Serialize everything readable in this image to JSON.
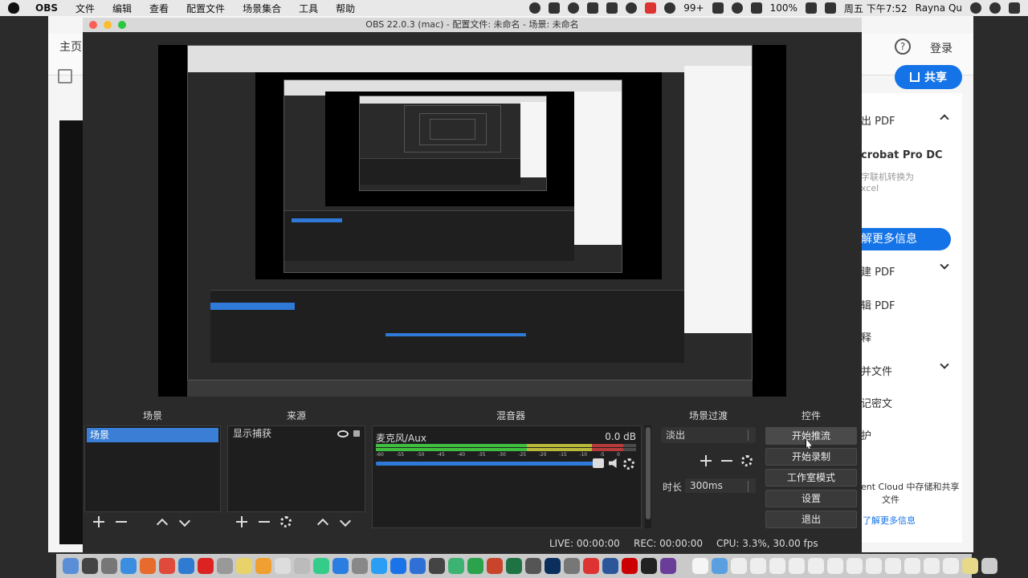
{
  "menubar": {
    "app_name": "OBS",
    "menus": [
      "文件",
      "编辑",
      "查看",
      "配置文件",
      "场景集合",
      "工具",
      "帮助"
    ],
    "notif_count": "99+",
    "battery": "100%",
    "clock": "周五 下午7:52",
    "user": "Rayna Qu"
  },
  "background_app": {
    "home_tab": "主页",
    "login": "登录",
    "share_button": "共享",
    "rows": [
      {
        "label": "出 PDF",
        "chevron": "up"
      },
      {
        "label": "crobat Pro DC"
      },
      {
        "label": "解更多信息"
      },
      {
        "label": "建 PDF",
        "chevron": "down"
      },
      {
        "label": "辑 PDF"
      },
      {
        "label": "释"
      },
      {
        "label": "并文件",
        "chevron": "down"
      },
      {
        "label": "记密文"
      },
      {
        "label": "护"
      }
    ],
    "small_texts": [
      "字联机转换为",
      "xcel"
    ],
    "cloud_text": "ent Cloud 中存储和共享",
    "cloud_text2": "文件",
    "cloud_link": "了解更多信息"
  },
  "obs": {
    "title": "OBS 22.0.3 (mac) - 配置文件: 未命名 - 场景: 未命名",
    "docks": {
      "scenes": {
        "title": "场景",
        "items": [
          "场景"
        ]
      },
      "sources": {
        "title": "来源",
        "items": [
          "显示捕获"
        ]
      },
      "mixer": {
        "title": "混音器",
        "channel": "麦克风/Aux",
        "db": "0.0 dB",
        "ticks": [
          "-60",
          "-55",
          "-50",
          "-45",
          "-40",
          "-35",
          "-30",
          "-25",
          "-20",
          "-15",
          "-10",
          "-5",
          "0"
        ],
        "level": 0.83
      },
      "transitions": {
        "title": "场景过渡",
        "selected": "淡出",
        "duration_label": "时长",
        "duration": "300ms"
      },
      "controls": {
        "title": "控件",
        "buttons": [
          "开始推流",
          "开始录制",
          "工作室模式",
          "设置",
          "退出"
        ]
      }
    },
    "status": {
      "live": "LIVE: 00:00:00",
      "rec": "REC: 00:00:00",
      "cpu": "CPU: 3.3%, 30.00 fps"
    }
  },
  "colors": {
    "accent": "#3a7fd5",
    "acrobat_blue": "#1473e6",
    "panel_bg": "#1e1e1e"
  }
}
